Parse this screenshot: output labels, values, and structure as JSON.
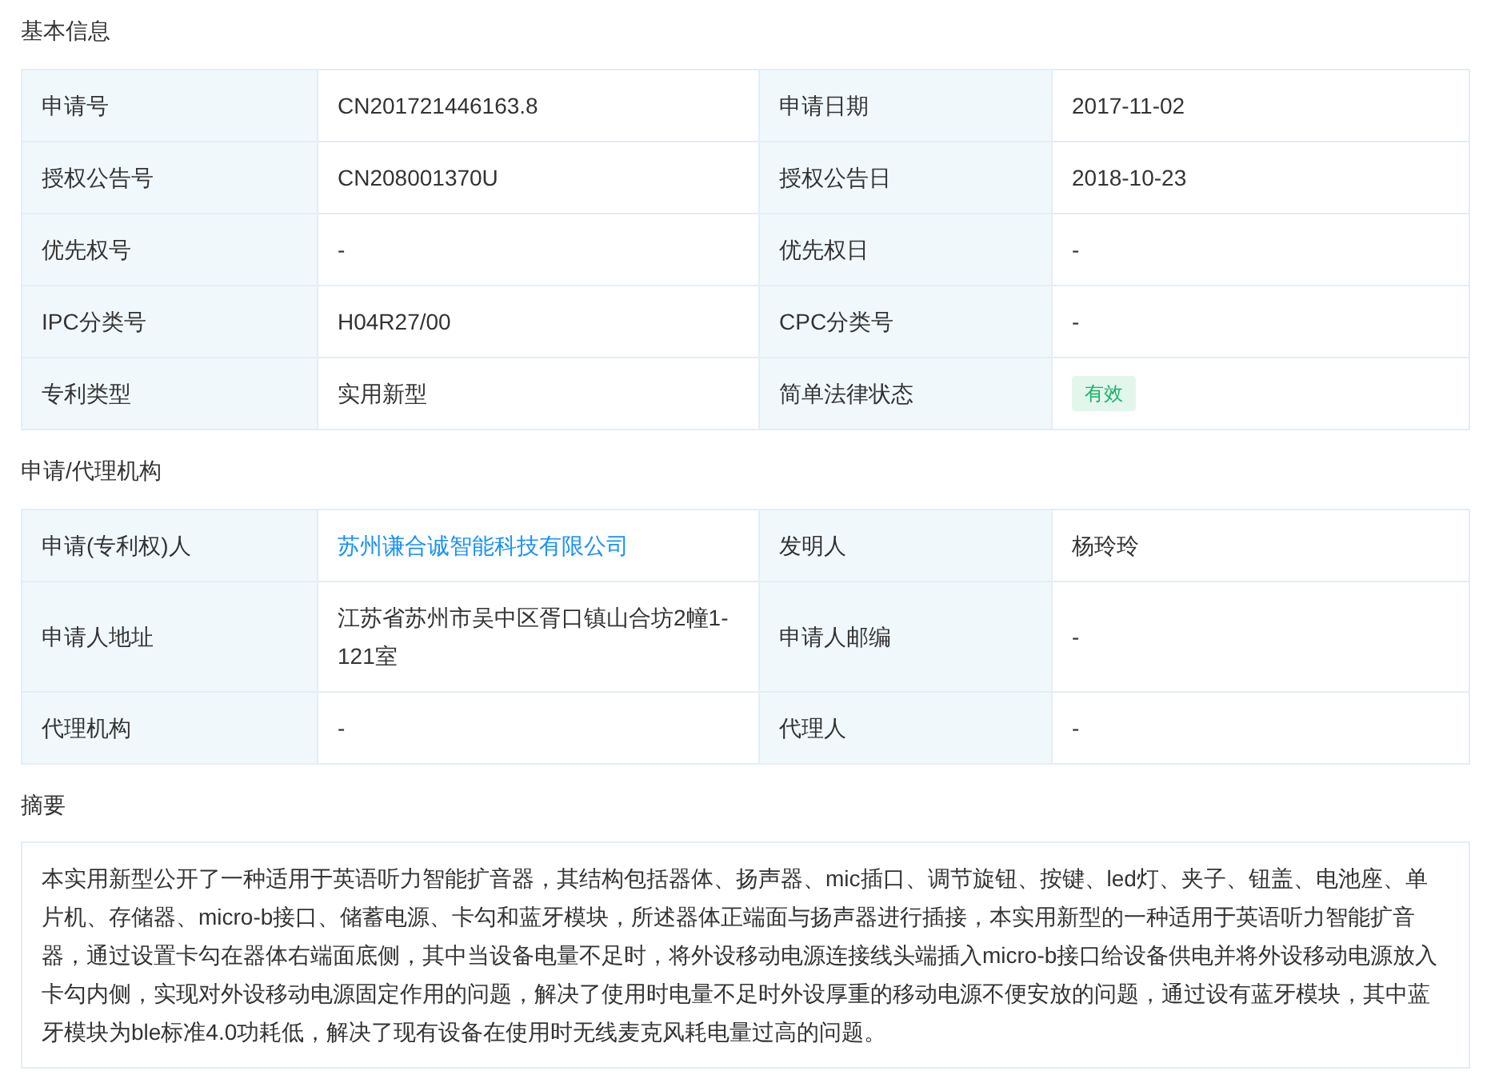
{
  "sections": [
    {
      "title": "基本信息",
      "rows": [
        [
          {
            "label": "申请号",
            "value": "CN201721446163.8",
            "kind": "text"
          },
          {
            "label": "申请日期",
            "value": "2017-11-02",
            "kind": "text"
          }
        ],
        [
          {
            "label": "授权公告号",
            "value": "CN208001370U",
            "kind": "text"
          },
          {
            "label": "授权公告日",
            "value": "2018-10-23",
            "kind": "text"
          }
        ],
        [
          {
            "label": "优先权号",
            "value": "-",
            "kind": "text"
          },
          {
            "label": "优先权日",
            "value": "-",
            "kind": "text"
          }
        ],
        [
          {
            "label": "IPC分类号",
            "value": "H04R27/00",
            "kind": "text"
          },
          {
            "label": "CPC分类号",
            "value": "-",
            "kind": "text"
          }
        ],
        [
          {
            "label": "专利类型",
            "value": "实用新型",
            "kind": "text"
          },
          {
            "label": "简单法律状态",
            "value": "有效",
            "kind": "badge"
          }
        ]
      ]
    },
    {
      "title": "申请/代理机构",
      "rows": [
        [
          {
            "label": "申请(专利权)人",
            "value": "苏州谦合诚智能科技有限公司",
            "kind": "link"
          },
          {
            "label": "发明人",
            "value": "杨玲玲",
            "kind": "text"
          }
        ],
        [
          {
            "label": "申请人地址",
            "value": "江苏省苏州市吴中区胥口镇山合坊2幢1-121室",
            "kind": "text"
          },
          {
            "label": "申请人邮编",
            "value": "-",
            "kind": "text"
          }
        ],
        [
          {
            "label": "代理机构",
            "value": "-",
            "kind": "text"
          },
          {
            "label": "代理人",
            "value": "-",
            "kind": "text"
          }
        ]
      ]
    }
  ],
  "abstract": {
    "title": "摘要",
    "text": "本实用新型公开了一种适用于英语听力智能扩音器，其结构包括器体、扬声器、mic插口、调节旋钮、按键、led灯、夹子、钮盖、电池座、单片机、存储器、micro-b接口、储蓄电源、卡勾和蓝牙模块，所述器体正端面与扬声器进行插接，本实用新型的一种适用于英语听力智能扩音器，通过设置卡勾在器体右端面底侧，其中当设备电量不足时，将外设移动电源连接线头端插入micro-b接口给设备供电并将外设移动电源放入卡勾内侧，实现对外设移动电源固定作用的问题，解决了使用时电量不足时外设厚重的移动电源不便安放的问题，通过设有蓝牙模块，其中蓝牙模块为ble标准4.0功耗低，解决了现有设备在使用时无线麦克风耗电量过高的问题。"
  }
}
